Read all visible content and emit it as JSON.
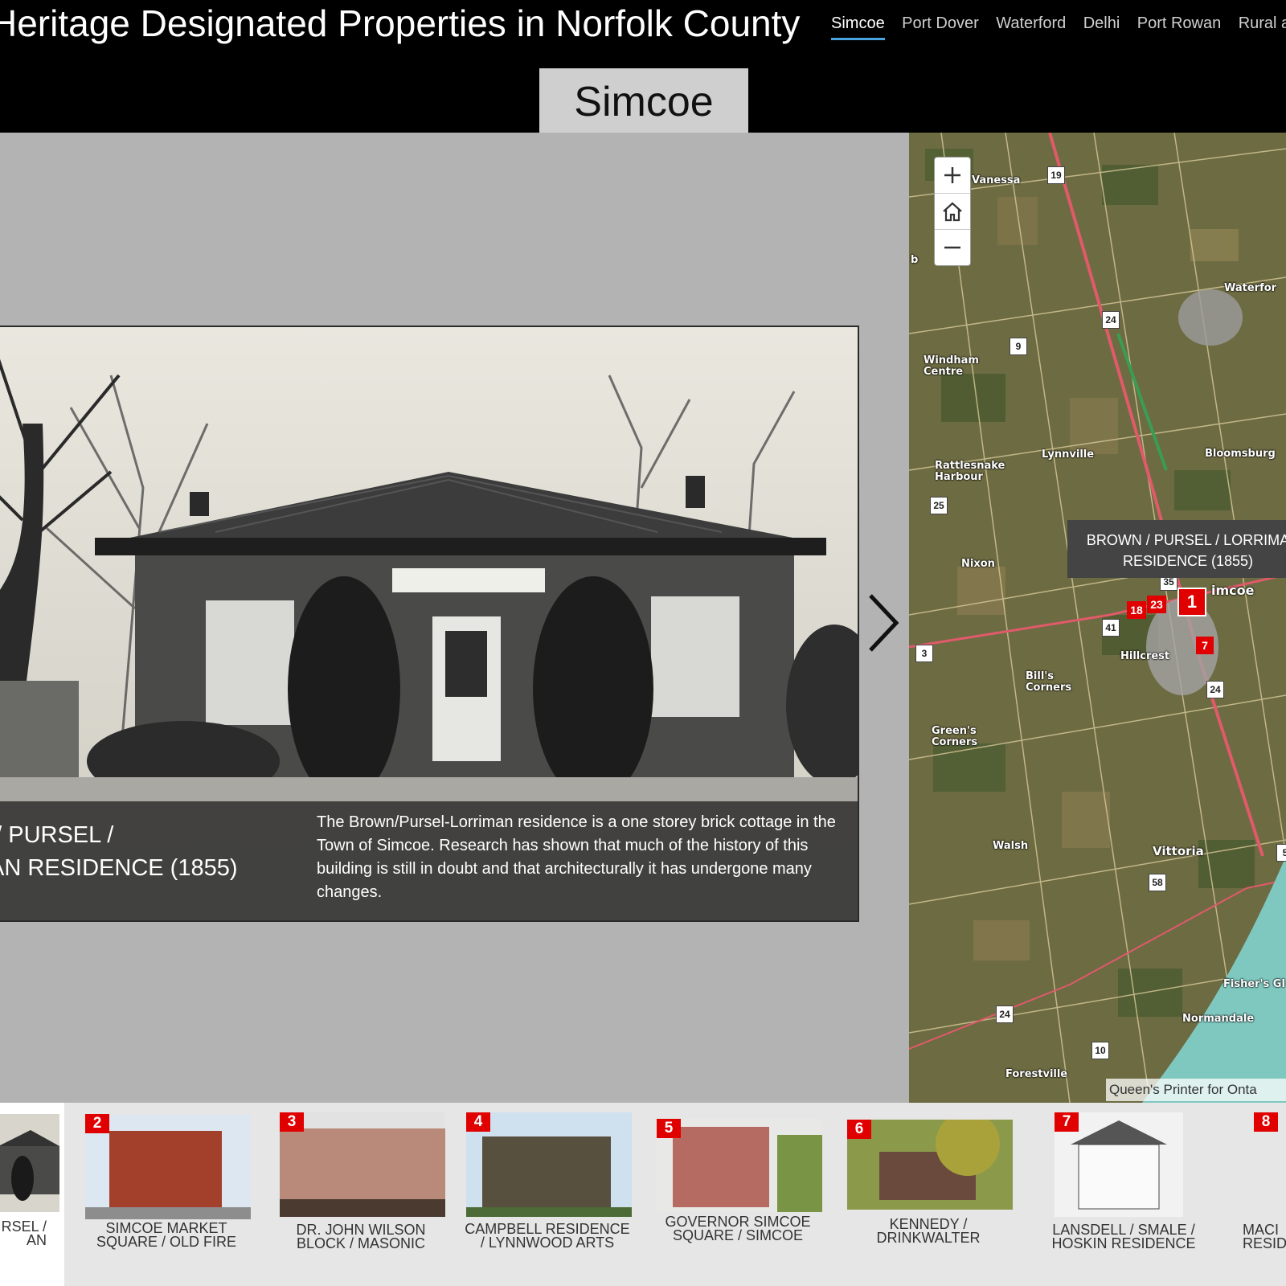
{
  "header": {
    "title": "Heritage Designated Properties in Norfolk County",
    "nav": [
      "Simcoe",
      "Port Dover",
      "Waterford",
      "Delhi",
      "Port Rowan",
      "Rural a"
    ],
    "active_nav": "Simcoe",
    "section_tab": "Simcoe"
  },
  "feature": {
    "title": "I / PURSEL /\nIAN RESIDENCE (1855)",
    "description": "The Brown/Pursel-Lorriman residence is a one storey brick cottage in the Town of Simcoe. Research has shown that much of the history of this building is still in doubt and that architecturally it has undergone many changes."
  },
  "map": {
    "popup": "BROWN / PURSEL / LORRIMA\nRESIDENCE (1855)",
    "attribution": "Queen's Printer for Onta",
    "places": [
      "Vanessa",
      "Waterfor",
      "Windham\nCentre",
      "Lynnville",
      "Bloomsburg",
      "Rattlesnake\nHarbour",
      "Nixon",
      "imcoe",
      "Hillcrest",
      "Bill's\nCorners",
      "Green's\nCorners",
      "Walsh",
      "Vittoria",
      "Fisher's Gl",
      "Normandale",
      "Forestville",
      "b"
    ],
    "shields": [
      "19",
      "24",
      "9",
      "25",
      "35",
      "41",
      "3",
      "24",
      "58",
      "24",
      "10",
      "5"
    ],
    "markers": [
      "1",
      "18",
      "23",
      "7"
    ]
  },
  "strip": {
    "items": [
      {
        "number": "",
        "label": "IRSEL /\nAN"
      },
      {
        "number": "2",
        "label": "SIMCOE MARKET\nSQUARE / OLD FIRE"
      },
      {
        "number": "3",
        "label": "DR. JOHN WILSON\nBLOCK / MASONIC"
      },
      {
        "number": "4",
        "label": "CAMPBELL RESIDENCE\n/ LYNNWOOD ARTS"
      },
      {
        "number": "5",
        "label": "GOVERNOR SIMCOE\nSQUARE / SIMCOE"
      },
      {
        "number": "6",
        "label": "KENNEDY /\nDRINKWALTER"
      },
      {
        "number": "7",
        "label": "LANSDELL / SMALE /\nHOSKIN RESIDENCE"
      },
      {
        "number": "8",
        "label": "MACI\nRESID"
      }
    ]
  }
}
